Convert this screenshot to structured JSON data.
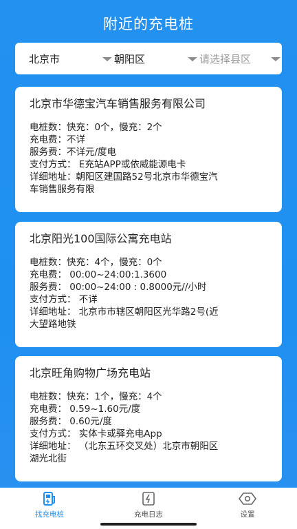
{
  "header": {
    "title": "附近的充电桩"
  },
  "filters": {
    "city": "北京市",
    "district": "朝阳区",
    "county_placeholder": "请选择县区"
  },
  "stations": [
    {
      "name": "北京市华德宝汽车销售服务有限公司",
      "details": [
        "电桩数：快充：0个，慢充：2个",
        "充电费：不详",
        "服务费：不详元/度电",
        "支付方式：  E充站APP或依威能源电卡",
        "详细地址：朝阳区建国路52号北京市华德宝汽",
        "车销售服务有限"
      ]
    },
    {
      "name": "北京阳光100国际公寓充电站",
      "details": [
        "电桩数：快充：4个，慢充：0个",
        "充电费：  00:00~24:00:1.3600",
        "服务费：  00:00~24:00 : 0.8000元//小时",
        "支付方式：  不详",
        "详细地址：  北京市市辖区朝阳区光华路2号(近",
        "大望路地铁"
      ]
    },
    {
      "name": "北京旺角购物广场充电站",
      "details": [
        "电桩数：快充：1个，慢充：4个",
        "充电费：  0.59~1.60元/度",
        "服务费：  0.60元/度",
        "支付方式：  实体卡或驿充电App",
        "详细地址：  （北东五环交叉处）北京市朝阳区",
        "湖光北街"
      ]
    }
  ],
  "tabbar": {
    "tabs": [
      {
        "label": "找充电桩",
        "icon": "charging-station-icon",
        "active": true
      },
      {
        "label": "充电日志",
        "icon": "charge-log-icon",
        "active": false
      },
      {
        "label": "设置",
        "icon": "settings-icon",
        "active": false
      }
    ]
  },
  "colors": {
    "accent": "#1f8ff2",
    "card": "#ffffff",
    "text": "#222222"
  }
}
